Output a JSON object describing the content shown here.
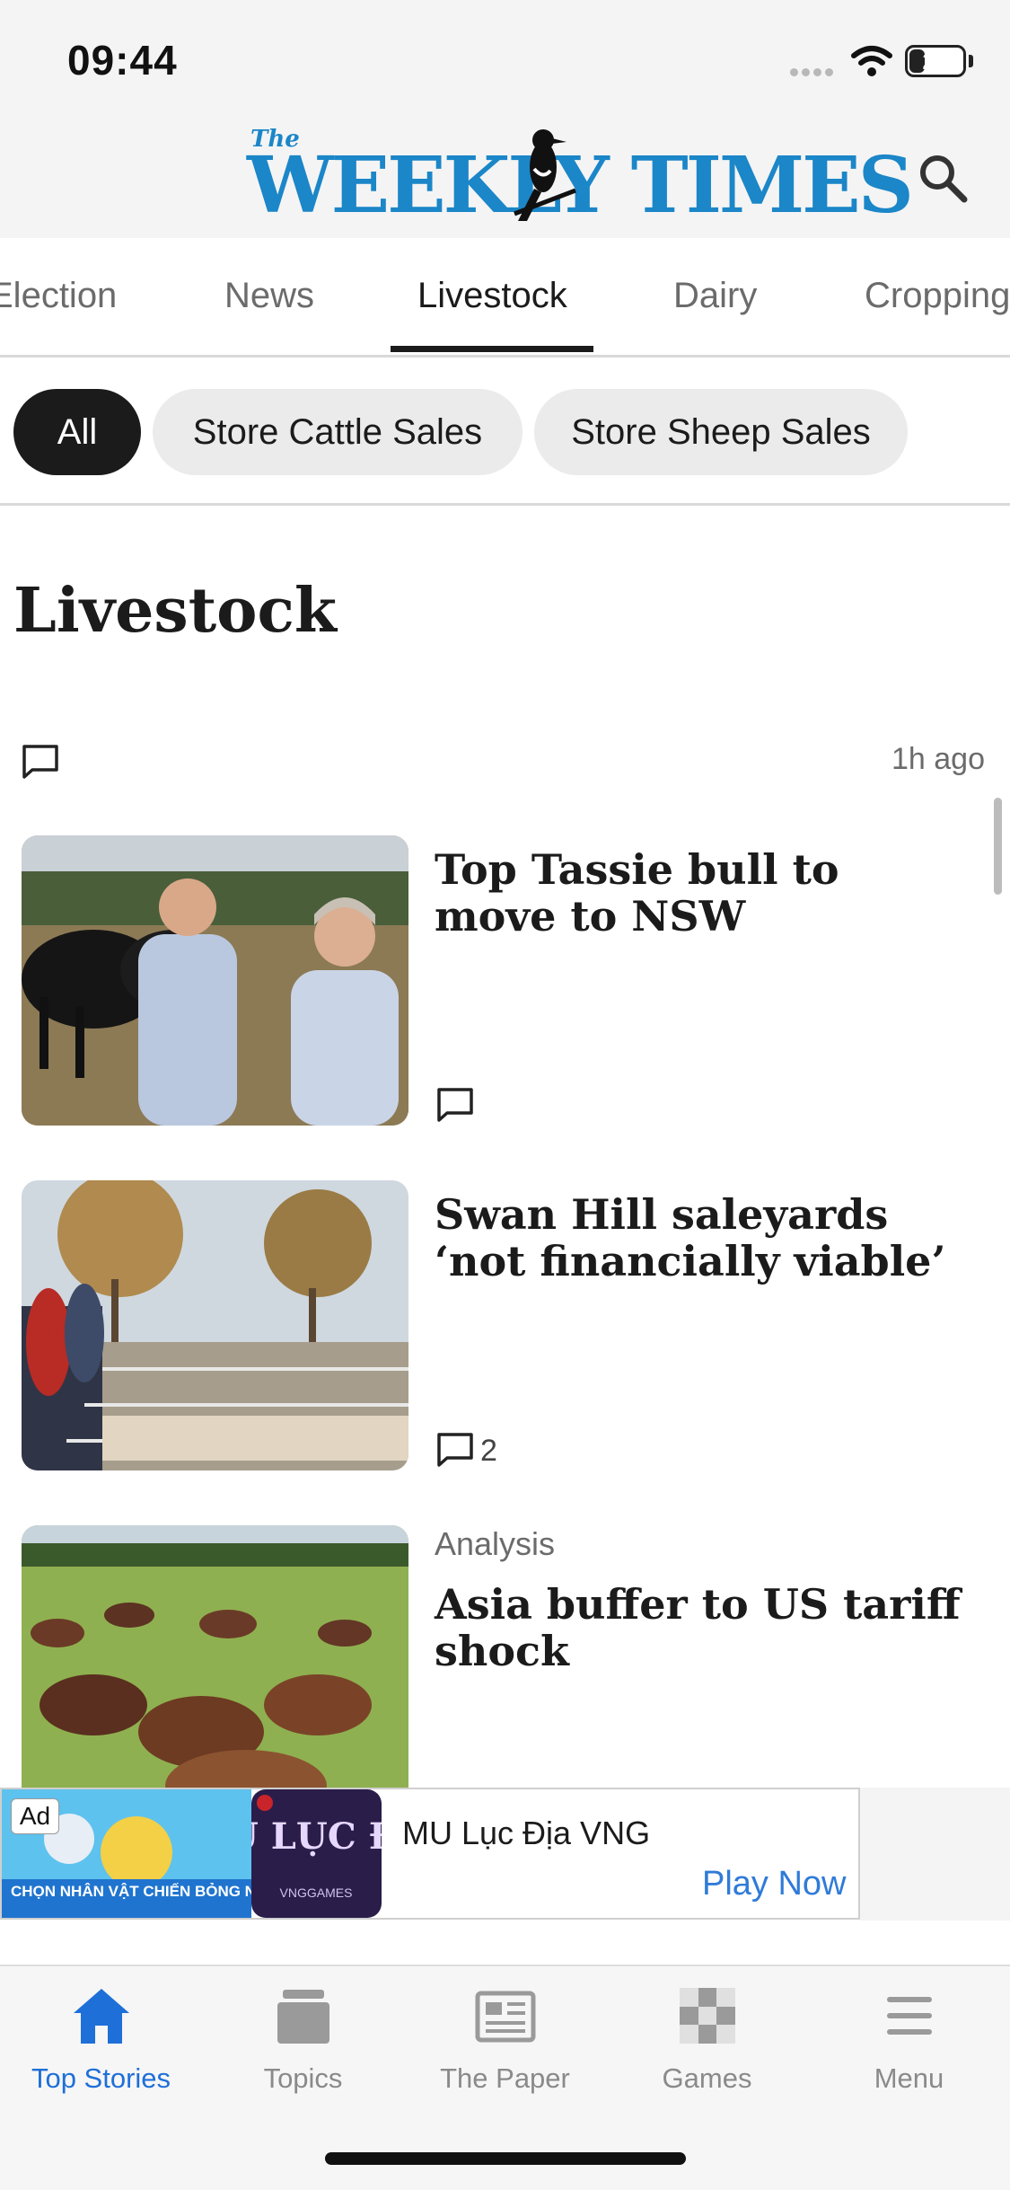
{
  "status_bar": {
    "time": "09:44",
    "battery": "27",
    "battery_level": 0.27
  },
  "header": {
    "logo_the": "The",
    "logo_main": "WEEKLY TIMES",
    "search_icon": "search-icon"
  },
  "tabs": [
    {
      "label": "Election",
      "active": false
    },
    {
      "label": "News",
      "active": false
    },
    {
      "label": "Livestock",
      "active": true
    },
    {
      "label": "Dairy",
      "active": false
    },
    {
      "label": "Cropping",
      "active": false
    }
  ],
  "chips": [
    {
      "label": "All",
      "active": true
    },
    {
      "label": "Store Cattle Sales",
      "active": false
    },
    {
      "label": "Store Sheep Sales",
      "active": false
    }
  ],
  "section": {
    "title": "Livestock",
    "time_ago": "1h ago"
  },
  "articles": [
    {
      "headline": "Top Tassie bull to move to NSW",
      "kicker": "",
      "comments": ""
    },
    {
      "headline": "Swan Hill saleyards ‘not financially viable’",
      "kicker": "",
      "comments": "2"
    },
    {
      "headline": "Asia buffer to US tariff shock",
      "kicker": "Analysis",
      "comments": ""
    }
  ],
  "ad": {
    "badge": "Ad",
    "banner_text": "CHỌN NHÂN VẬT CHIẾN BỎNG NƯỚC",
    "logo_text": "MU LỤC ĐỊA",
    "logo_sub": "VNGGAMES",
    "name": "MU Lục Địa VNG",
    "cta": "Play Now"
  },
  "bottom_nav": [
    {
      "label": "Top Stories",
      "icon": "home-icon",
      "active": true
    },
    {
      "label": "Topics",
      "icon": "topics-icon",
      "active": false
    },
    {
      "label": "The Paper",
      "icon": "newspaper-icon",
      "active": false
    },
    {
      "label": "Games",
      "icon": "games-icon",
      "active": false
    },
    {
      "label": "Menu",
      "icon": "menu-icon",
      "active": false
    }
  ],
  "colors": {
    "brand": "#1b86c8",
    "active_nav": "#1f6fd8",
    "chip_active": "#1b1b1b"
  }
}
